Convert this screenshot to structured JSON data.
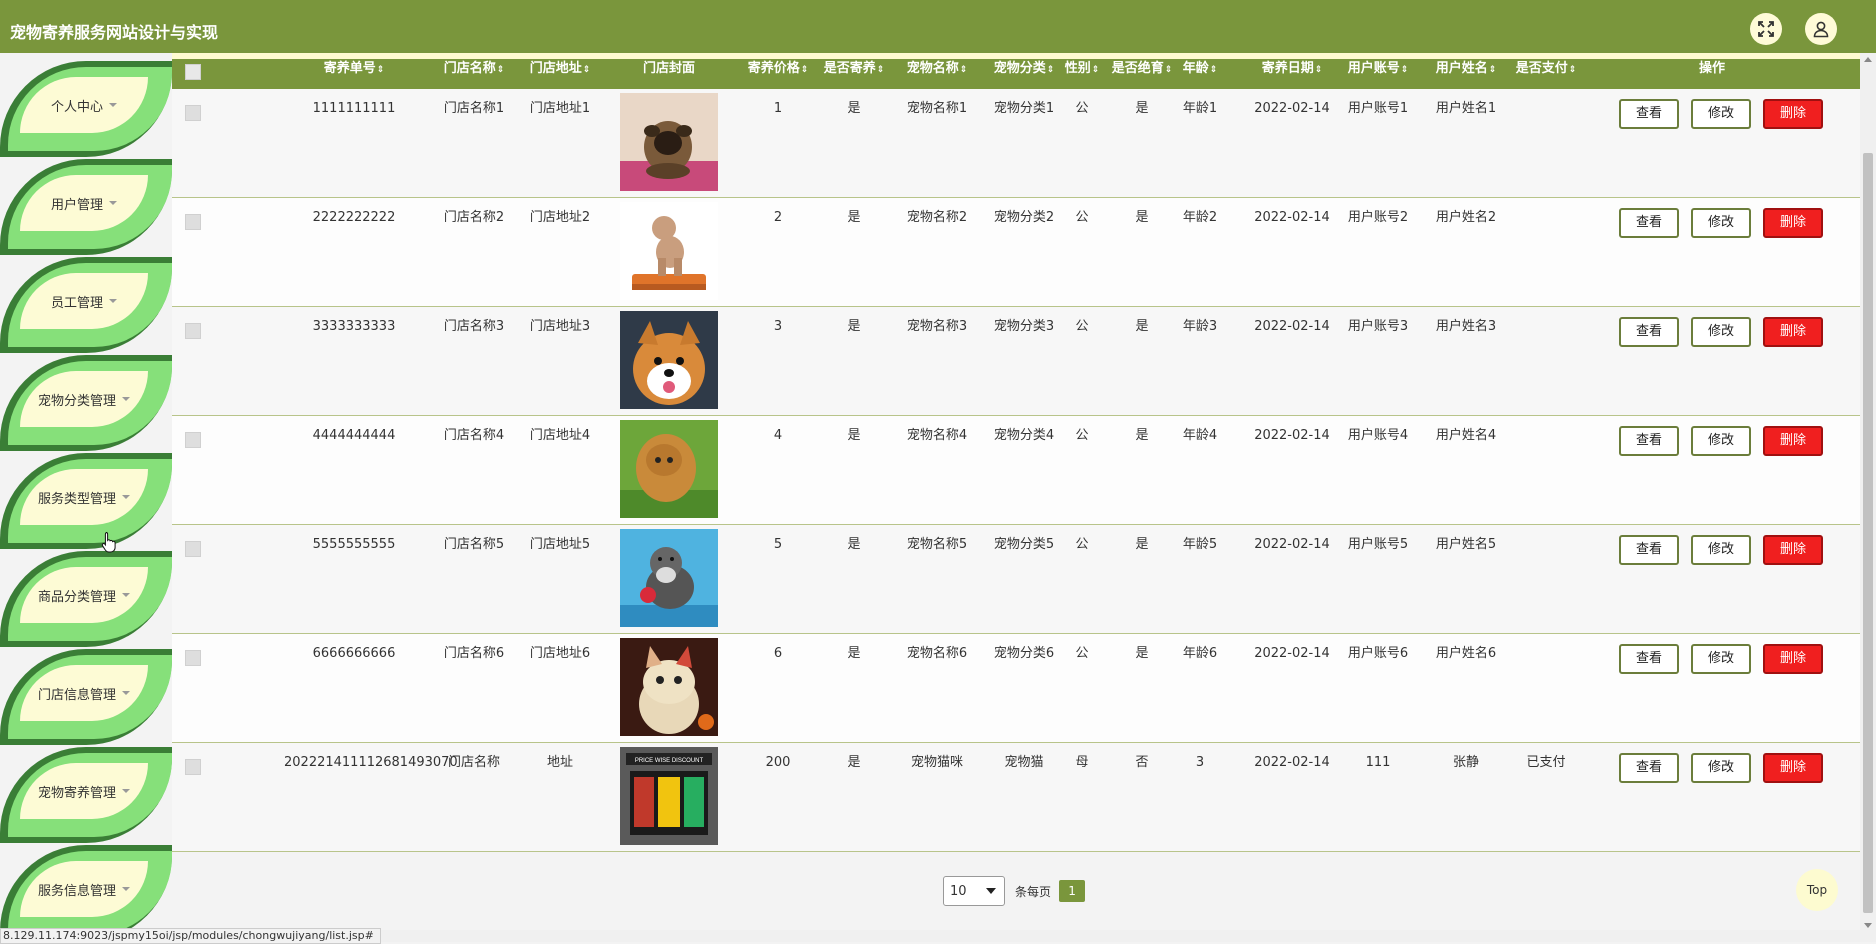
{
  "header": {
    "title": "宠物寄养服务网站设计与实现",
    "fullscreen_icon": "expand-icon",
    "user_icon": "user-icon"
  },
  "sidebar": {
    "items": [
      {
        "label": "个人中心"
      },
      {
        "label": "用户管理"
      },
      {
        "label": "员工管理"
      },
      {
        "label": "宠物分类管理"
      },
      {
        "label": "服务类型管理"
      },
      {
        "label": "商品分类管理"
      },
      {
        "label": "门店信息管理"
      },
      {
        "label": "宠物寄养管理"
      },
      {
        "label": "服务信息管理"
      }
    ]
  },
  "table": {
    "columns": [
      "寄养单号",
      "门店名称",
      "门店地址",
      "门店封面",
      "寄养价格",
      "是否寄养",
      "宠物名称",
      "宠物分类",
      "性别",
      "是否绝育",
      "年龄",
      "寄养日期",
      "用户账号",
      "用户姓名",
      "是否支付",
      "操作"
    ],
    "rows": [
      {
        "order_no": "1111111111",
        "store_name": "门店名称1",
        "store_addr": "门店地址1",
        "price": "1",
        "boarded": "是",
        "pet_name": "宠物名称1",
        "pet_cat": "宠物分类1",
        "gender": "公",
        "neutered": "是",
        "age": "年龄1",
        "date": "2022-02-14",
        "account": "用户账号1",
        "user_name": "用户姓名1",
        "paid": "",
        "cover": "pug"
      },
      {
        "order_no": "2222222222",
        "store_name": "门店名称2",
        "store_addr": "门店地址2",
        "price": "2",
        "boarded": "是",
        "pet_name": "宠物名称2",
        "pet_cat": "宠物分类2",
        "gender": "公",
        "neutered": "是",
        "age": "年龄2",
        "date": "2022-02-14",
        "account": "用户账号2",
        "user_name": "用户姓名2",
        "paid": "",
        "cover": "poodle"
      },
      {
        "order_no": "3333333333",
        "store_name": "门店名称3",
        "store_addr": "门店地址3",
        "price": "3",
        "boarded": "是",
        "pet_name": "宠物名称3",
        "pet_cat": "宠物分类3",
        "gender": "公",
        "neutered": "是",
        "age": "年龄3",
        "date": "2022-02-14",
        "account": "用户账号3",
        "user_name": "用户姓名3",
        "paid": "",
        "cover": "shiba"
      },
      {
        "order_no": "4444444444",
        "store_name": "门店名称4",
        "store_addr": "门店地址4",
        "price": "4",
        "boarded": "是",
        "pet_name": "宠物名称4",
        "pet_cat": "宠物分类4",
        "gender": "公",
        "neutered": "是",
        "age": "年龄4",
        "date": "2022-02-14",
        "account": "用户账号4",
        "user_name": "用户姓名4",
        "paid": "",
        "cover": "chow"
      },
      {
        "order_no": "5555555555",
        "store_name": "门店名称5",
        "store_addr": "门店地址5",
        "price": "5",
        "boarded": "是",
        "pet_name": "宠物名称5",
        "pet_cat": "宠物分类5",
        "gender": "公",
        "neutered": "是",
        "age": "年龄5",
        "date": "2022-02-14",
        "account": "用户账号5",
        "user_name": "用户姓名5",
        "paid": "",
        "cover": "schnauzer"
      },
      {
        "order_no": "6666666666",
        "store_name": "门店名称6",
        "store_addr": "门店地址6",
        "price": "6",
        "boarded": "是",
        "pet_name": "宠物名称6",
        "pet_cat": "宠物分类6",
        "gender": "公",
        "neutered": "是",
        "age": "年龄6",
        "date": "2022-02-14",
        "account": "用户账号6",
        "user_name": "用户姓名6",
        "paid": "",
        "cover": "cat"
      },
      {
        "order_no": "202221411112681493070",
        "store_name": "门店名称",
        "store_addr": "地址",
        "price": "200",
        "boarded": "是",
        "pet_name": "宠物猫咪",
        "pet_cat": "宠物猫",
        "gender": "母",
        "neutered": "否",
        "age": "3",
        "date": "2022-02-14",
        "account": "111",
        "user_name": "张静",
        "paid": "已支付",
        "cover": "storefront",
        "storefront_sign": "PRICE WISE DISCOUNT"
      }
    ],
    "actions": {
      "view": "查看",
      "edit": "修改",
      "delete": "删除"
    }
  },
  "pagination": {
    "page_size": "10",
    "per_page_label": "条每页",
    "current_page": "1"
  },
  "back_to_top": "Top",
  "status_bar": {
    "url": "8.129.11.174:9023/jspmy15oi/jsp/modules/chongwujiyang/list.jsp#"
  },
  "colors": {
    "primary": "#7a963c",
    "leaf_dark": "#3a7e36",
    "leaf_light": "#86e07a",
    "cream": "#fdfbd5",
    "delete": "#f01f1f"
  }
}
